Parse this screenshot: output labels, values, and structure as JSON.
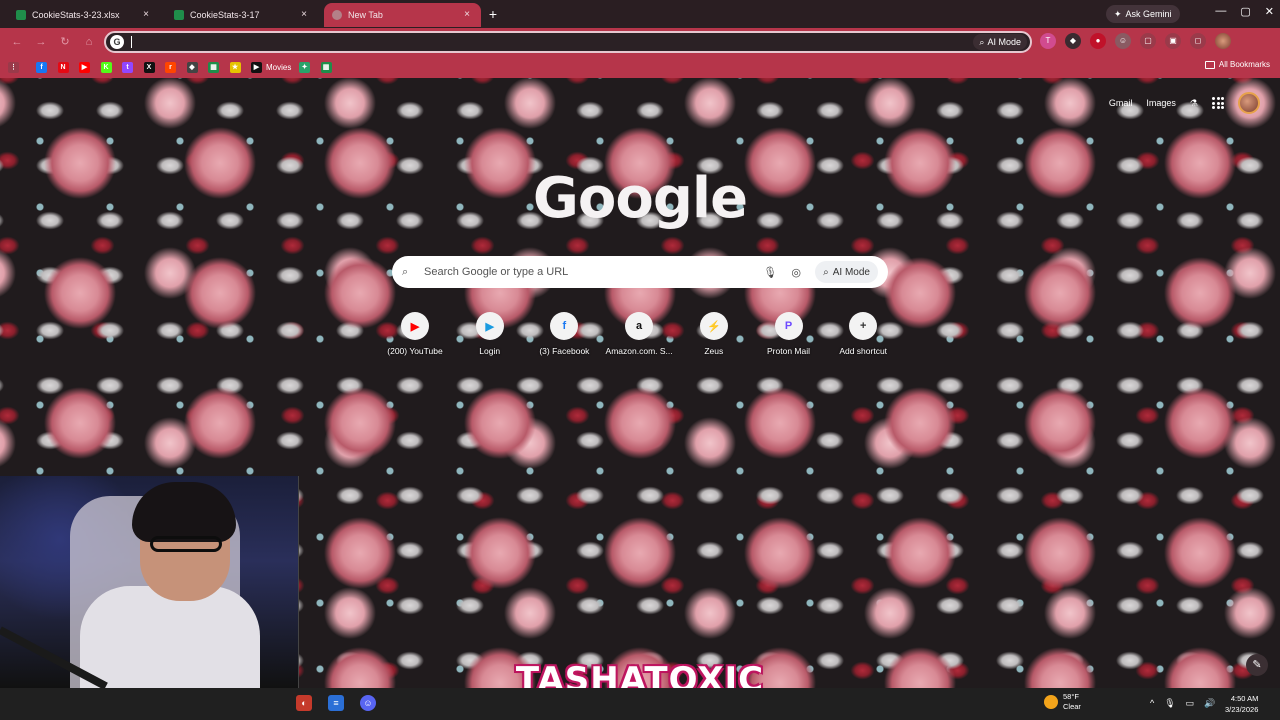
{
  "browser": {
    "tabs": [
      {
        "title": "CookieStats-3-23.xlsx",
        "icon": "sheets-icon",
        "active": false
      },
      {
        "title": "CookieStats-3-17",
        "icon": "sheets-icon",
        "active": false
      },
      {
        "title": "New Tab",
        "icon": "chrome-icon",
        "active": true
      }
    ],
    "ask_gemini": "Ask Gemini",
    "new_tab_symbol": "+",
    "close_symbol": "×",
    "window_controls": {
      "minimize": "—",
      "maximize": "▢",
      "close": "✕"
    },
    "omnibox": {
      "value": "",
      "ai_mode_label": "AI Mode"
    },
    "bookmarks": [
      {
        "label": "",
        "icon": "facebook-icon",
        "color": "#1877f2",
        "glyph": "f"
      },
      {
        "label": "",
        "icon": "netflix-icon",
        "color": "#e50914",
        "glyph": "N"
      },
      {
        "label": "",
        "icon": "youtube-icon",
        "color": "#ff0000",
        "glyph": "▶"
      },
      {
        "label": "",
        "icon": "kick-icon",
        "color": "#53fc18",
        "glyph": "K"
      },
      {
        "label": "",
        "icon": "twitch-icon",
        "color": "#9146ff",
        "glyph": "t"
      },
      {
        "label": "",
        "icon": "x-icon",
        "color": "#111111",
        "glyph": "X"
      },
      {
        "label": "",
        "icon": "reddit-icon",
        "color": "#ff4500",
        "glyph": "r"
      },
      {
        "label": "",
        "icon": "extension-icon",
        "color": "#444444",
        "glyph": "◆"
      },
      {
        "label": "",
        "icon": "sheets-icon",
        "color": "#1f8d4a",
        "glyph": "▦"
      },
      {
        "label": "",
        "icon": "star-icon",
        "color": "#e5c300",
        "glyph": "★"
      },
      {
        "label": "Movies",
        "icon": "movies-icon",
        "color": "#111111",
        "glyph": "▶"
      },
      {
        "label": "",
        "icon": "leaf-icon",
        "color": "#2aa36a",
        "glyph": "✦"
      },
      {
        "label": "",
        "icon": "sheets-icon",
        "color": "#1f8d4a",
        "glyph": "▦"
      }
    ],
    "all_bookmarks": "All Bookmarks"
  },
  "ntp": {
    "top_links": [
      "Gmail",
      "Images"
    ],
    "logo": "Google",
    "search_placeholder": "Search Google or type a URL",
    "search_ai_mode": "AI Mode",
    "shortcuts": [
      {
        "label": "(200) YouTube",
        "icon": "youtube-icon",
        "color": "#ff0000",
        "glyph": "▶"
      },
      {
        "label": "Login",
        "icon": "play-icon",
        "color": "#1a9be0",
        "glyph": "▶"
      },
      {
        "label": "(3) Facebook",
        "icon": "facebook-icon",
        "color": "#1877f2",
        "glyph": "f"
      },
      {
        "label": "Amazon.com. S...",
        "icon": "amazon-icon",
        "color": "#111111",
        "glyph": "a"
      },
      {
        "label": "Zeus",
        "icon": "zeus-icon",
        "color": "#e0232b",
        "glyph": "⚡"
      },
      {
        "label": "Proton Mail",
        "icon": "proton-mail-icon",
        "color": "#6d4aff",
        "glyph": "P"
      },
      {
        "label": "Add shortcut",
        "icon": "plus-icon",
        "color": "#333333",
        "glyph": "+"
      }
    ]
  },
  "overlay": {
    "streamer_name": "TASHATOXIC"
  },
  "taskbar": {
    "weather_temp": "58°F",
    "weather_desc": "Clear",
    "time": "4:50 AM",
    "date": "3/23/2026"
  }
}
